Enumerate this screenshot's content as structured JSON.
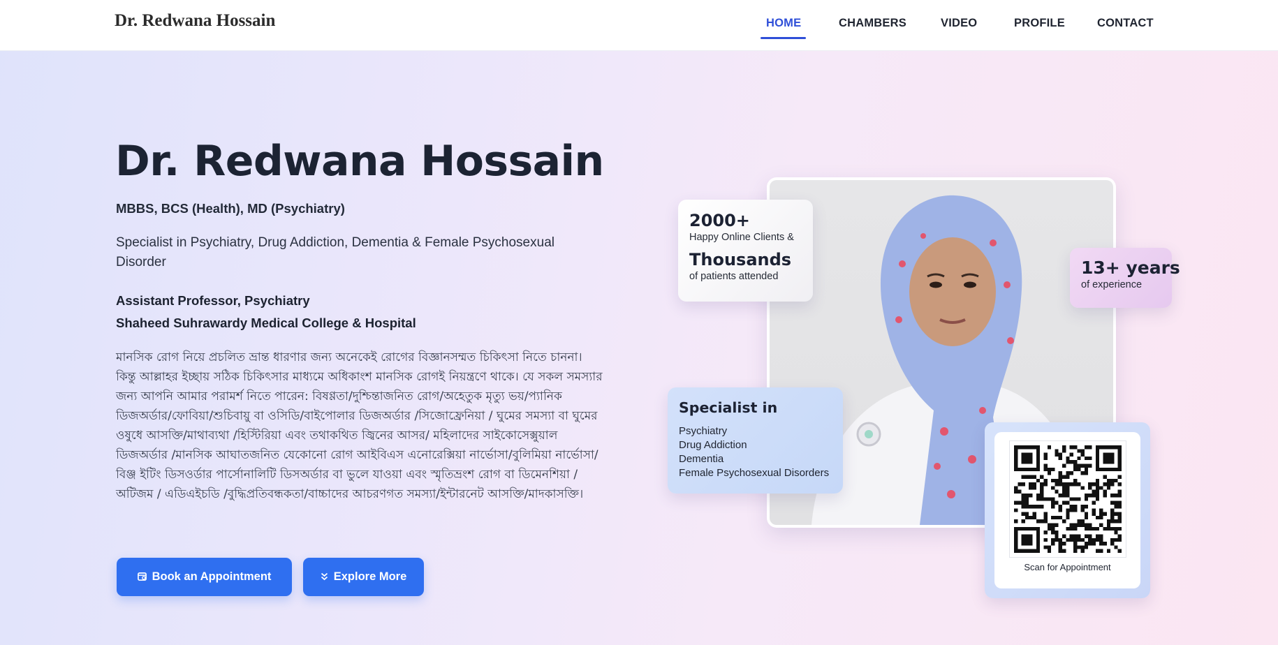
{
  "brand": "Dr. Redwana Hossain",
  "nav": {
    "items": [
      {
        "label": "HOME",
        "active": true
      },
      {
        "label": "CHAMBERS",
        "active": false
      },
      {
        "label": "VIDEO",
        "active": false
      },
      {
        "label": "PROFILE",
        "active": false
      },
      {
        "label": "CONTACT",
        "active": false
      }
    ],
    "active_color": "#2f4fd8"
  },
  "hero": {
    "name": "Dr. Redwana Hossain",
    "degrees": "MBBS, BCS (Health), MD (Psychiatry)",
    "specialty": "Specialist in Psychiatry, Drug Addiction, Dementia & Female Psychosexual Disorder",
    "position_title": "Assistant Professor, Psychiatry",
    "institution": "Shaheed Suhrawardy Medical College & Hospital",
    "bangla_text": "মানসিক রোগ নিয়ে প্রচলিত ভ্রান্ত ধারণার জন্য অনেকেই রোগের বিজ্ঞানসম্মত চিকিৎসা নিতে চাননা। কিন্তু আল্লাহর ইচ্ছায় সঠিক চিকিৎসার মাধ্যমে অধিকাংশ মানসিক রোগই নিয়ন্ত্রণে থাকে। যে সকল সমস্যার জন্য আপনি আমার পরামর্শ নিতে পারেন: বিষণ্ণতা/দুশ্চিন্তাজনিত রোগ/অহেতুক মৃত্যু ভয়/প্যানিক ডিজঅর্ডার/ফোবিয়া/শুচিবায়ু বা ওসিডি/বাইপোলার ডিজঅর্ডার /সিজোফ্রেনিয়া / ঘুমের সমস্যা বা ঘুমের ওষুধে আসক্তি/মাথাব্যথা /হিস্টিরিয়া এবং তথাকথিত জ্বিনের আসর/ মহিলাদের সাইকোসেক্সুয়াল ডিজঅর্ডার /মানসিক আঘাতজনিত যেকোনো রোগ আইবিএস এনোরেক্সিয়া নার্ভোসা/বুলিমিয়া নার্ভোসা/বিঞ্জ ইটিং ডিসওর্ডার পার্সোনালিটি ডিসঅর্ডার বা ভুলে যাওয়া এবং স্মৃতিভ্রংশ রোগ বা ডিমেনশিয়া / অটিজম / এডিএইচডি /বুদ্ধিপ্রতিবন্ধকতা/বাচ্চাদের আচরণগত সমস্যা/ইন্টারনেট আসক্তি/মাদকাসক্তি।",
    "buttons": {
      "book_label": "Book an Appointment",
      "book_icon": "calendar-icon",
      "explore_label": "Explore More",
      "explore_icon": "double-chevron-down-icon",
      "color": "#2f6ff0"
    }
  },
  "stats_card": {
    "clients_count": "2000+",
    "clients_label": "Happy Online Clients &",
    "patients_count": "Thousands",
    "patients_label": "of patients attended"
  },
  "experience_card": {
    "years": "13+ years",
    "label": "of experience"
  },
  "specialist_card": {
    "title": "Specialist in",
    "items": [
      "Psychiatry",
      "Drug Addiction",
      "Dementia",
      "Female Psychosexual Disorders"
    ]
  },
  "qr_card": {
    "label": "Scan for Appointment"
  }
}
